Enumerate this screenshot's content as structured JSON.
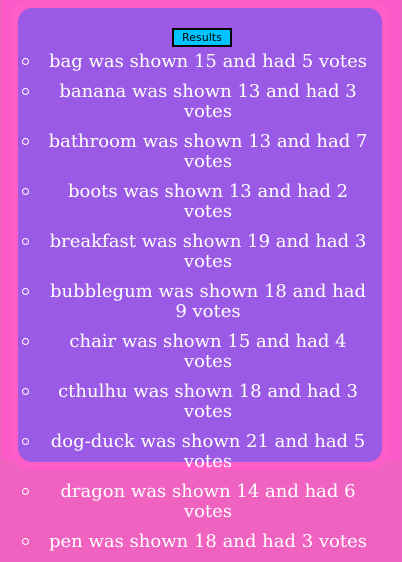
{
  "button": {
    "label": "Results"
  },
  "results": [
    "bag was shown 15 and had 5 votes",
    "banana was shown 13 and had 3 votes",
    "bathroom was shown 13 and had 7 votes",
    "boots was shown 13 and had 2 votes",
    "breakfast was shown 19 and had 3 votes",
    "bubblegum was shown 18 and had 9 votes",
    "chair was shown 15 and had 4 votes",
    "cthulhu was shown 18 and had 3 votes",
    "dog-duck was shown 21 and had 5 votes",
    "dragon was shown 14 and had 6 votes",
    "pen was shown 18 and had 3 votes"
  ],
  "colors": {
    "background": "#f062c0",
    "panel": "#9a5ae6",
    "border": "#ff5ec8",
    "button": "#00c4ff"
  }
}
